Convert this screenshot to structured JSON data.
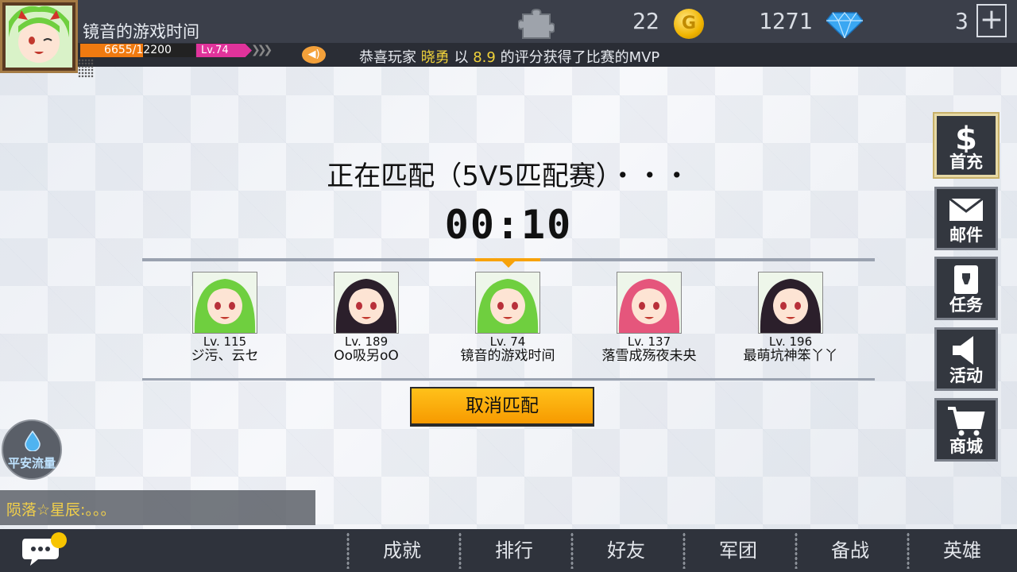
{
  "player": {
    "name": "镜音的游戏时间",
    "exp_text": "6655/12200",
    "exp_fraction": 0.545,
    "level": "Lv.74"
  },
  "resources": {
    "coins": "22",
    "gold": "1271",
    "gems": "3"
  },
  "announcement": {
    "prefix": "恭喜玩家",
    "player": "晓勇",
    "mid": "以",
    "score": "8.9",
    "suffix": "的评分获得了比赛的MVP"
  },
  "matching": {
    "title": "正在匹配（5V5匹配赛）・・・",
    "timer": "00:10",
    "cancel_label": "取消匹配"
  },
  "team": [
    {
      "level": "Lv. 115",
      "name": "ジ污、云セ",
      "hair": "#6fcf3f"
    },
    {
      "level": "Lv. 189",
      "name": "Oo吸另oO",
      "hair": "#2b1f2b"
    },
    {
      "level": "Lv. 74",
      "name": "镜音的游戏时间",
      "hair": "#6fcf3f"
    },
    {
      "level": "Lv. 137",
      "name": "落雪成殇夜未央",
      "hair": "#e5567c"
    },
    {
      "level": "Lv. 196",
      "name": "最萌坑神笨丫丫",
      "hair": "#2b1f2b"
    }
  ],
  "side_menu": [
    {
      "label": "首充",
      "icon": "dollar-icon"
    },
    {
      "label": "邮件",
      "icon": "mail-icon"
    },
    {
      "label": "任务",
      "icon": "quest-icon"
    },
    {
      "label": "活动",
      "icon": "speaker-icon"
    },
    {
      "label": "商城",
      "icon": "cart-icon"
    }
  ],
  "flow_badge": "平安流量",
  "chat": {
    "speaker": "陨落☆星辰",
    "message": ":。。。"
  },
  "bottom_nav": [
    "成就",
    "排行",
    "好友",
    "军团",
    "备战",
    "英雄"
  ],
  "colors": {
    "accent": "#f7a20a",
    "level_tag": "#e0339b",
    "exp": "#f07a10",
    "highlight": "#f0d23a"
  }
}
